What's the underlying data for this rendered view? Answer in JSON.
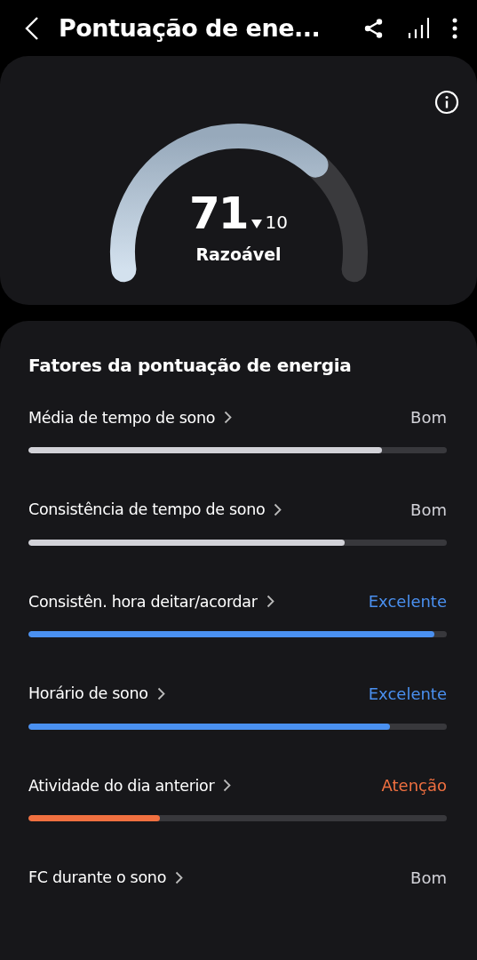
{
  "header": {
    "title": "Pontuação de ene..."
  },
  "score": {
    "value": "71",
    "change": "10",
    "rating": "Razoável"
  },
  "factors": {
    "title": "Fatores da pontuação de energia",
    "items": [
      {
        "label": "Média de tempo de sono",
        "status": "Bom",
        "color": "#d2d2d8",
        "level": 0.845
      },
      {
        "label": "Consistência de tempo de sono",
        "status": "Bom",
        "color": "#d2d2d8",
        "level": 0.755
      },
      {
        "label": "Consistên. hora deitar/acordar",
        "status": "Excelente",
        "color": "#4a90f0",
        "level": 0.97
      },
      {
        "label": "Horário de sono",
        "status": "Excelente",
        "color": "#4a90f0",
        "level": 0.865
      },
      {
        "label": "Atividade do dia anterior",
        "status": "Atenção",
        "color": "#f07040",
        "level": 0.315
      },
      {
        "label": "FC durante o sono",
        "status": "Bom",
        "color": "#d2d2d8"
      }
    ]
  }
}
